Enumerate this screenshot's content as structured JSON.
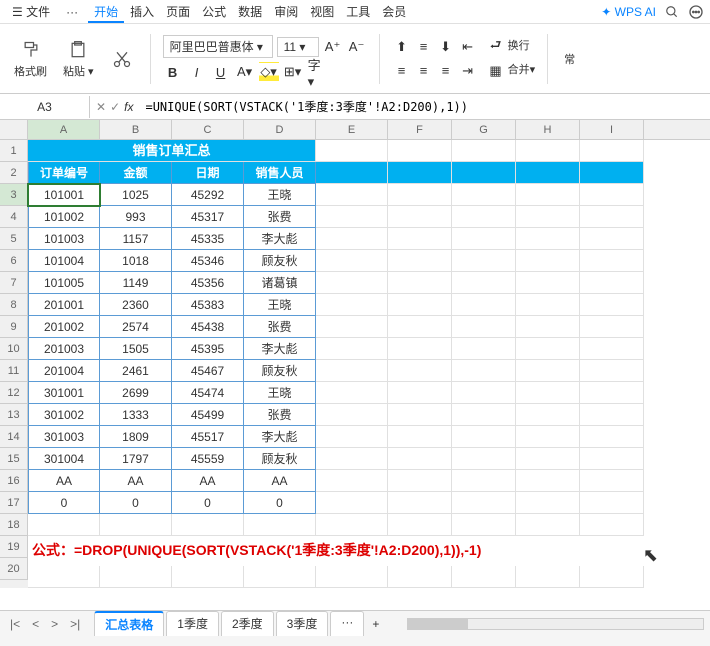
{
  "menu": {
    "file": "文件",
    "more": "···",
    "items": [
      "开始",
      "插入",
      "页面",
      "公式",
      "数据",
      "审阅",
      "视图",
      "工具",
      "会员"
    ],
    "active": "开始",
    "ai": "WPS AI"
  },
  "ribbon": {
    "format_painter": "格式刷",
    "paste": "粘贴",
    "font_name": "阿里巴巴普惠体",
    "font_size": "11",
    "wrap": "换行",
    "merge": "合并"
  },
  "formula_bar": {
    "cell_ref": "A3",
    "formula": "=UNIQUE(SORT(VSTACK('1季度:3季度'!A2:D200),1))"
  },
  "columns": [
    "A",
    "B",
    "C",
    "D",
    "E",
    "F",
    "G",
    "H",
    "I"
  ],
  "row_count": 20,
  "table": {
    "title": "销售订单汇总",
    "headers": [
      "订单编号",
      "金额",
      "日期",
      "销售人员"
    ],
    "rows": [
      [
        "101001",
        "1025",
        "45292",
        "王晓"
      ],
      [
        "101002",
        "993",
        "45317",
        "张费"
      ],
      [
        "101003",
        "1157",
        "45335",
        "李大彪"
      ],
      [
        "101004",
        "1018",
        "45346",
        "顾友秋"
      ],
      [
        "101005",
        "1149",
        "45356",
        "诸葛镇"
      ],
      [
        "201001",
        "2360",
        "45383",
        "王晓"
      ],
      [
        "201002",
        "2574",
        "45438",
        "张费"
      ],
      [
        "201003",
        "1505",
        "45395",
        "李大彪"
      ],
      [
        "201004",
        "2461",
        "45467",
        "顾友秋"
      ],
      [
        "301001",
        "2699",
        "45474",
        "王晓"
      ],
      [
        "301002",
        "1333",
        "45499",
        "张费"
      ],
      [
        "301003",
        "1809",
        "45517",
        "李大彪"
      ],
      [
        "301004",
        "1797",
        "45559",
        "顾友秋"
      ],
      [
        "AA",
        "AA",
        "AA",
        "AA"
      ],
      [
        "0",
        "0",
        "0",
        "0"
      ]
    ]
  },
  "note": "公式：=DROP(UNIQUE(SORT(VSTACK('1季度:3季度'!A2:D200),1)),-1)",
  "tabs": {
    "items": [
      "汇总表格",
      "1季度",
      "2季度",
      "3季度",
      "···"
    ],
    "active": "汇总表格"
  }
}
